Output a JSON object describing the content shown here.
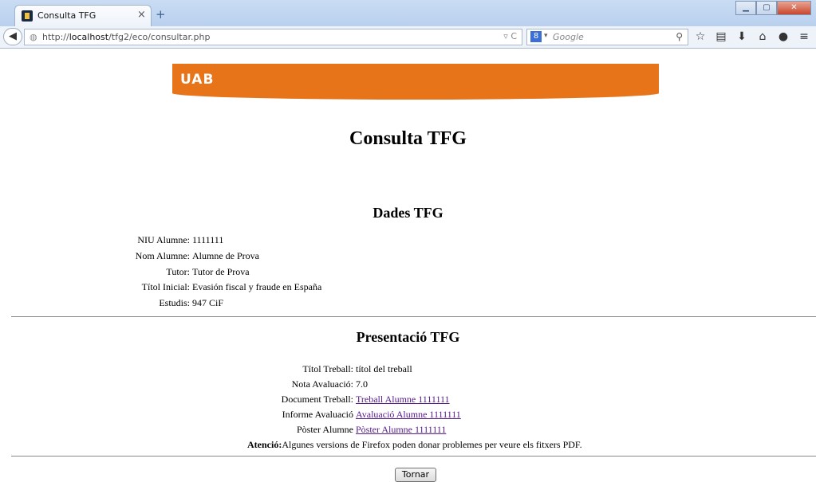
{
  "browser": {
    "tab_title": "Consulta TFG",
    "tab_close": "×",
    "new_tab": "+",
    "url_prefix": "http://",
    "url_host": "localhost",
    "url_path": "/tfg2/eco/consultar.php",
    "search_placeholder": "Google",
    "search_engine_letter": "8"
  },
  "banner": {
    "logo": "UAB",
    "color": "#e8741a"
  },
  "page": {
    "title": "Consulta TFG",
    "dades": {
      "heading": "Dades TFG",
      "rows": [
        {
          "label": "NIU Alumne:",
          "value": "1111111"
        },
        {
          "label": "Nom Alumne:",
          "value": "Alumne de Prova"
        },
        {
          "label": "Tutor:",
          "value": "Tutor de Prova"
        },
        {
          "label": "Títol Inicial:",
          "value": "Evasión fiscal y fraude en España"
        },
        {
          "label": "Estudis:",
          "value": "947 CiF"
        }
      ]
    },
    "presentacio": {
      "heading": "Presentació TFG",
      "titol_label": "Títol Treball:",
      "titol_value": "títol del treball",
      "nota_label": "Nota Avaluació:",
      "nota_value": "7.0",
      "document_label": "Document Treball:",
      "document_link": "Treball Alumne 1111111",
      "informe_label": "Informe Avaluació",
      "informe_link": "Avaluació Alumne 1111111",
      "poster_label": "Pòster Alumne",
      "poster_link": "Pòster Alumne 1111111",
      "atencio_label": "Atenció:",
      "atencio_text": "Algunes versions de Firefox poden donar problemes per veure els fitxers PDF."
    },
    "tornar_button": "Tornar"
  }
}
